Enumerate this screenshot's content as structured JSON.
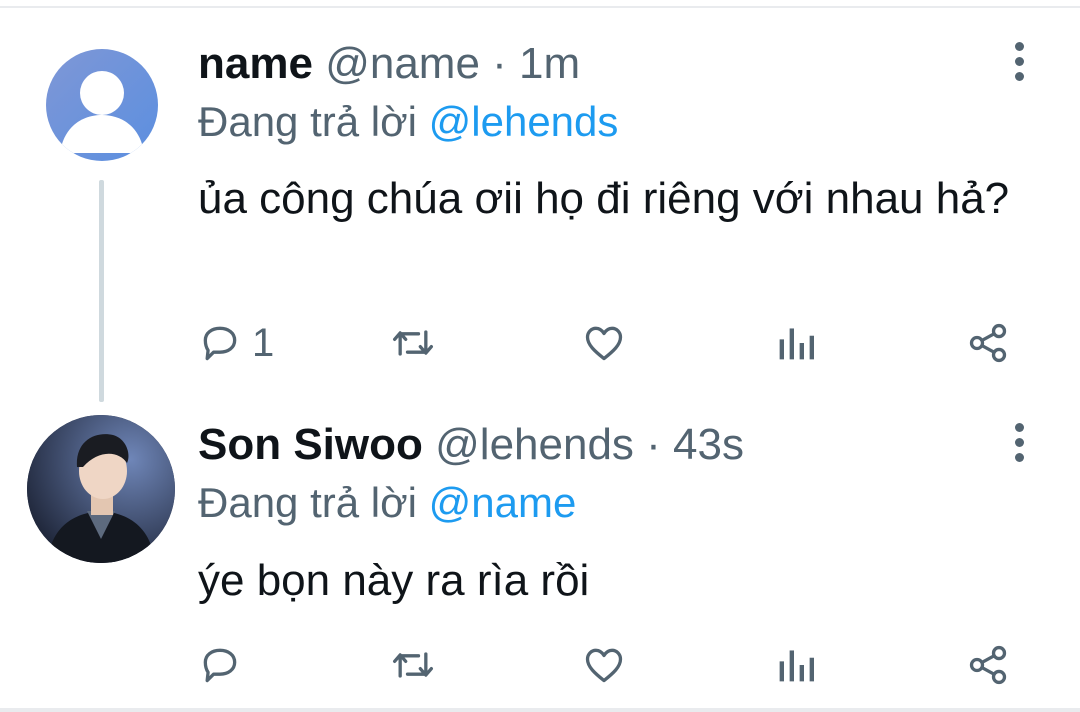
{
  "colors": {
    "accent": "#1d9bf0",
    "muted": "#536471",
    "text": "#0f1419",
    "thread_line": "#cfd9de"
  },
  "tweets": [
    {
      "author_name": "name",
      "handle": "@name",
      "separator": "·",
      "time": "1m",
      "reply_label": "Đang trả lời",
      "reply_to": "@lehends",
      "text": "ủa công chúa ơii họ đi riêng với nhau hả?",
      "avatar": "default-person-avatar",
      "actions": {
        "reply_icon": "reply-icon",
        "reply_count": "1",
        "retweet_icon": "retweet-icon",
        "like_icon": "heart-icon",
        "views_icon": "analytics-icon",
        "share_icon": "share-icon"
      },
      "more_icon": "more-vertical-icon"
    },
    {
      "author_name": "Son Siwoo",
      "handle": "@lehends",
      "separator": "·",
      "time": "43s",
      "reply_label": "Đang trả lời",
      "reply_to": "@name",
      "text": "ýe bọn này ra rìa rồi",
      "avatar": "profile-photo-avatar",
      "actions": {
        "reply_icon": "reply-icon",
        "reply_count": "",
        "retweet_icon": "retweet-icon",
        "like_icon": "heart-icon",
        "views_icon": "analytics-icon",
        "share_icon": "share-icon"
      },
      "more_icon": "more-vertical-icon"
    }
  ]
}
